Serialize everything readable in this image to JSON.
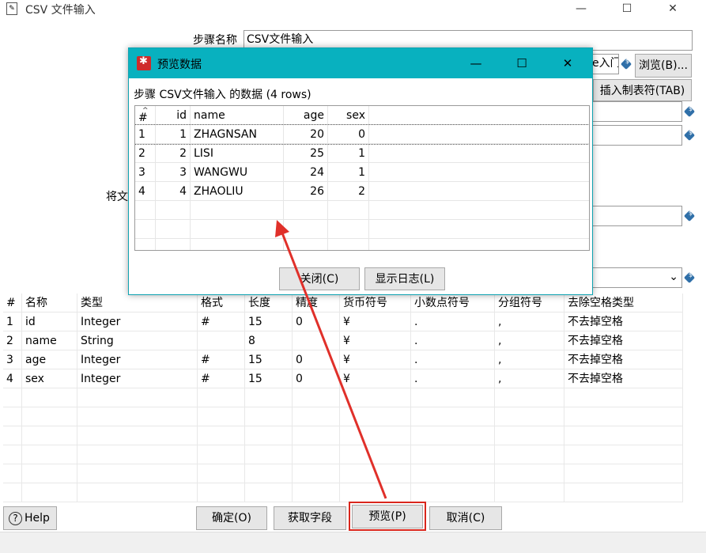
{
  "window": {
    "title": "CSV 文件输入",
    "icon": "document-icon",
    "controls": {
      "minimize": "—",
      "maximize": "☐",
      "close": "✕"
    }
  },
  "form": {
    "step_name_label": "步骤名称",
    "step_name_value": "CSV文件输入",
    "filename_partial": "e入门",
    "browse_label": "浏览(B)...",
    "insert_tab_label": "插入制表符(TAB)",
    "filename_to_label_partial": "将文"
  },
  "fields_table": {
    "columns": [
      "#",
      "名称",
      "类型",
      "格式",
      "长度",
      "精度",
      "货币符号",
      "小数点符号",
      "分组符号",
      "去除空格类型"
    ],
    "rows": [
      [
        "1",
        "id",
        "Integer",
        "#",
        "15",
        "0",
        "¥",
        ".",
        ",",
        "不去掉空格"
      ],
      [
        "2",
        "name",
        "String",
        "",
        "8",
        "",
        "¥",
        ".",
        ",",
        "不去掉空格"
      ],
      [
        "3",
        "age",
        "Integer",
        "#",
        "15",
        "0",
        "¥",
        ".",
        ",",
        "不去掉空格"
      ],
      [
        "4",
        "sex",
        "Integer",
        "#",
        "15",
        "0",
        "¥",
        ".",
        ",",
        "不去掉空格"
      ]
    ]
  },
  "buttons": {
    "help": "Help",
    "ok": "确定(O)",
    "get_fields": "获取字段",
    "preview": "预览(P)",
    "cancel": "取消(C)"
  },
  "preview_dialog": {
    "title": "预览数据",
    "subtitle": "步骤 CSV文件输入 的数据  (4 rows)",
    "controls": {
      "minimize": "—",
      "maximize": "☐",
      "close": "✕"
    },
    "columns": [
      "#",
      "id",
      "name",
      "age",
      "sex"
    ],
    "rows": [
      [
        "1",
        "1",
        "ZHAGNSAN",
        "20",
        "0"
      ],
      [
        "2",
        "2",
        "LISI",
        "25",
        "1"
      ],
      [
        "3",
        "3",
        "WANGWU",
        "24",
        "1"
      ],
      [
        "4",
        "4",
        "ZHAOLIU",
        "26",
        "2"
      ]
    ],
    "close_button": "关闭(C)",
    "show_log_button": "显示日志(L)"
  },
  "colors": {
    "dialog_titlebar": "#08b1bf",
    "highlight": "#d9261c",
    "arrow": "#e0302a"
  }
}
